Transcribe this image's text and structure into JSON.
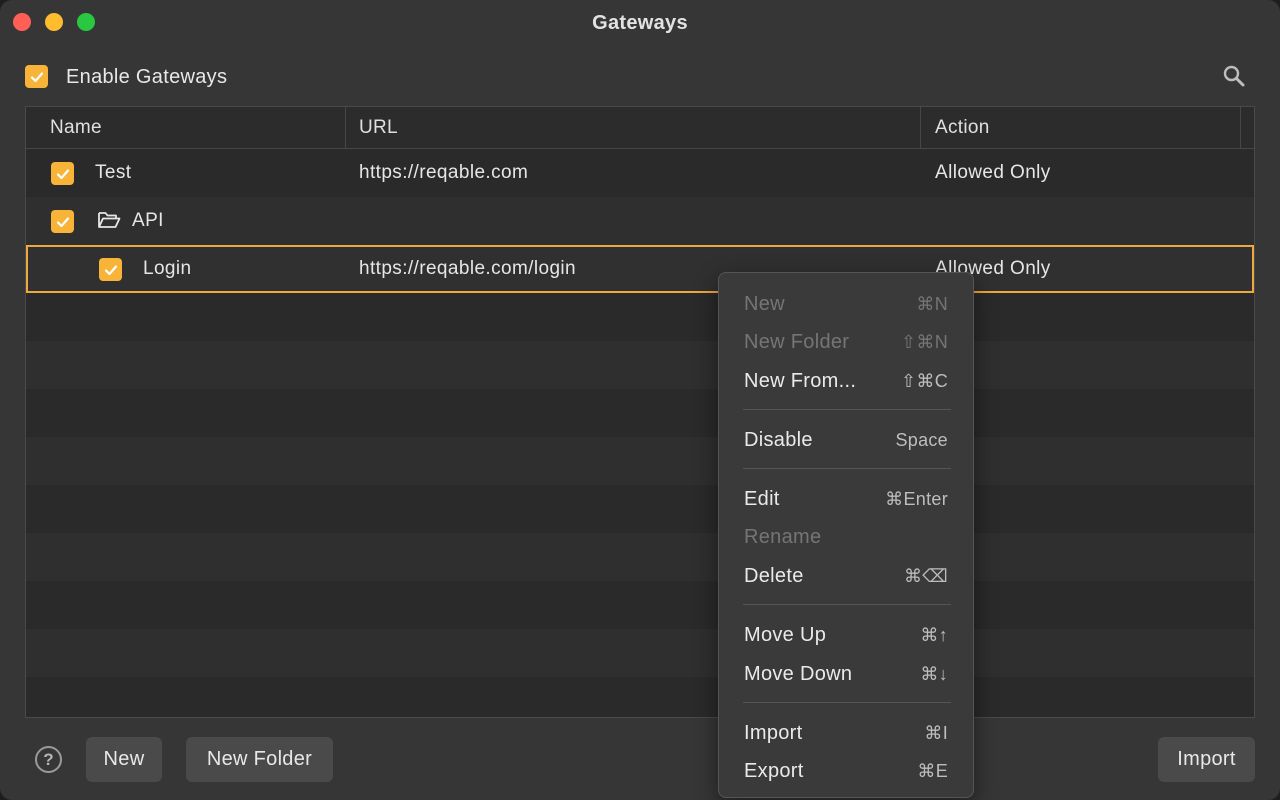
{
  "window": {
    "title": "Gateways"
  },
  "toolbar": {
    "enable_label": "Enable Gateways",
    "enable_checked": true,
    "search_icon": "search-icon"
  },
  "table": {
    "columns": [
      "Name",
      "URL",
      "Action"
    ],
    "rows": [
      {
        "name": "Test",
        "url": "https://reqable.com",
        "action": "Allowed Only",
        "checked": true,
        "type": "item",
        "depth": 0
      },
      {
        "name": "API",
        "url": "",
        "action": "",
        "checked": true,
        "type": "folder",
        "depth": 0
      },
      {
        "name": "Login",
        "url": "https://reqable.com/login",
        "action": "Allowed Only",
        "checked": true,
        "type": "item",
        "depth": 1,
        "selected": true
      }
    ]
  },
  "footer": {
    "new_label": "New",
    "new_folder_label": "New Folder",
    "import_label": "Import",
    "help_label": "?"
  },
  "context_menu": {
    "items": [
      {
        "label": "New",
        "shortcut": "⌘N",
        "enabled": false
      },
      {
        "label": "New Folder",
        "shortcut": "⇧⌘N",
        "enabled": false
      },
      {
        "label": "New From...",
        "shortcut": "⇧⌘C",
        "enabled": true
      },
      {
        "label": "Disable",
        "shortcut": "Space",
        "enabled": true
      },
      {
        "label": "Edit",
        "shortcut": "⌘Enter",
        "enabled": true
      },
      {
        "label": "Rename",
        "shortcut": "",
        "enabled": false
      },
      {
        "label": "Delete",
        "shortcut": "⌘⌫",
        "enabled": true
      },
      {
        "label": "Move Up",
        "shortcut": "⌘↑",
        "enabled": true
      },
      {
        "label": "Move Down",
        "shortcut": "⌘↓",
        "enabled": true
      },
      {
        "label": "Import",
        "shortcut": "⌘I",
        "enabled": true
      },
      {
        "label": "Export",
        "shortcut": "⌘E",
        "enabled": true
      }
    ]
  },
  "colors": {
    "accent": "#f7b439",
    "selection_border": "#f0a73c",
    "window_bg": "#363636"
  }
}
